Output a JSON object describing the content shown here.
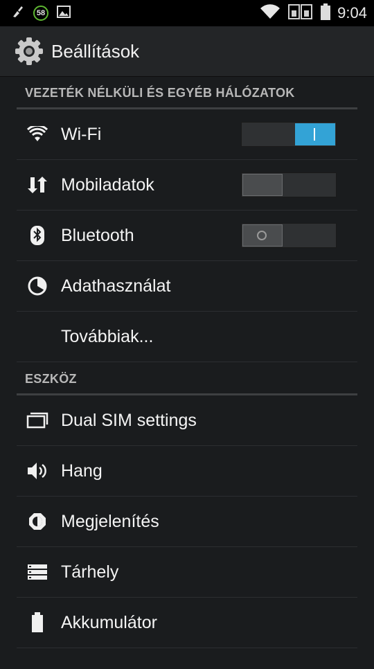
{
  "status_bar": {
    "badge": "58",
    "time": "9:04",
    "icons": [
      "clean-icon",
      "badge-icon",
      "image-icon",
      "wifi-icon",
      "sim-cards-icon",
      "battery-icon"
    ]
  },
  "action_bar": {
    "title": "Beállítások",
    "icon": "settings-gear-icon"
  },
  "sections": [
    {
      "header": "VEZETÉK NÉLKÜLI ÉS EGYÉB HÁLÓZATOK",
      "items": [
        {
          "label": "Wi-Fi",
          "icon": "wifi-icon",
          "toggle": "on"
        },
        {
          "label": "Mobiladatok",
          "icon": "mobile-data-icon",
          "toggle": "off"
        },
        {
          "label": "Bluetooth",
          "icon": "bluetooth-icon",
          "toggle": "off"
        },
        {
          "label": "Adathasználat",
          "icon": "data-usage-icon"
        },
        {
          "label": "Továbbiak..."
        }
      ]
    },
    {
      "header": "ESZKÖZ",
      "items": [
        {
          "label": "Dual SIM settings",
          "icon": "dual-sim-icon"
        },
        {
          "label": "Hang",
          "icon": "sound-icon"
        },
        {
          "label": "Megjelenítés",
          "icon": "display-brightness-icon"
        },
        {
          "label": "Tárhely",
          "icon": "storage-icon"
        },
        {
          "label": "Akkumulátor",
          "icon": "battery-icon"
        }
      ]
    }
  ],
  "colors": {
    "accent": "#33a3d6",
    "background": "#1a1c1e",
    "action_bar": "#232527"
  }
}
